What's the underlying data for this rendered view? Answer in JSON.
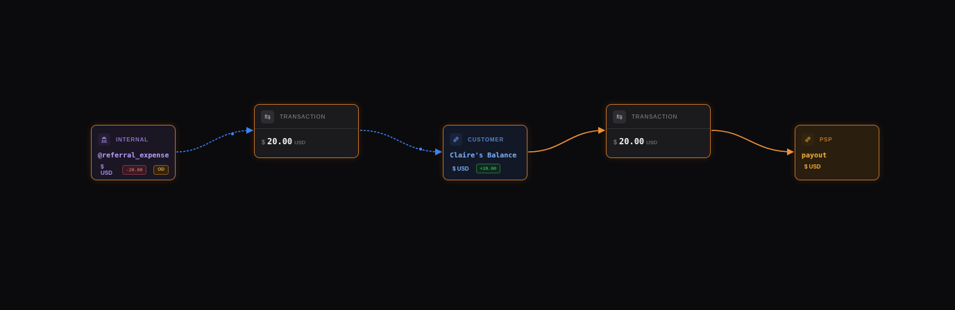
{
  "colors": {
    "flow_pending": "#3b82f6",
    "flow_settled": "#f0923a",
    "node_border": "#c06f26"
  },
  "nodes": {
    "internal": {
      "type_label": "INTERNAL",
      "icon": "bank-icon",
      "name": "@referral_expense",
      "currency": "$ USD",
      "balance": "-20.00",
      "flag": "OD"
    },
    "txn1": {
      "type_label": "TRANSACTION",
      "icon": "swap-arrows-icon",
      "symbol": "$",
      "amount": "20.00",
      "currency": "USD"
    },
    "customer": {
      "type_label": "CUSTOMER",
      "icon": "link-icon",
      "name": "Claire's Balance",
      "currency": "$ USD",
      "balance": "+20.00"
    },
    "txn2": {
      "type_label": "TRANSACTION",
      "icon": "swap-arrows-icon",
      "symbol": "$",
      "amount": "20.00",
      "currency": "USD"
    },
    "psp": {
      "type_label": "PSP",
      "icon": "link-icon",
      "name": "payout",
      "currency": "$ USD"
    }
  },
  "edges": [
    {
      "from": "internal",
      "to": "txn1",
      "style": "dashed",
      "color": "#3b82f6"
    },
    {
      "from": "txn1",
      "to": "customer",
      "style": "dashed",
      "color": "#3b82f6"
    },
    {
      "from": "customer",
      "to": "txn2",
      "style": "solid",
      "color": "#f0923a"
    },
    {
      "from": "txn2",
      "to": "psp",
      "style": "solid",
      "color": "#f0923a"
    }
  ]
}
